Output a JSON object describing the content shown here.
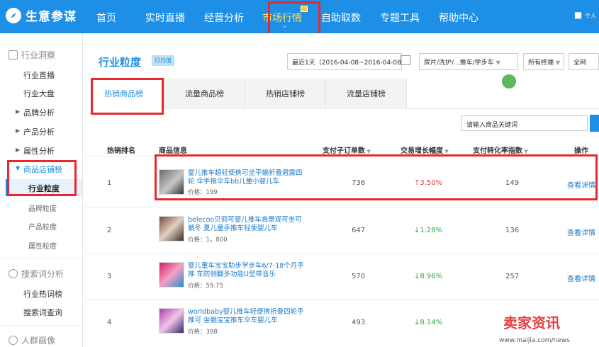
{
  "app": {
    "name": "生意参谋"
  },
  "nav": {
    "items": [
      "首页",
      "实时直播",
      "经营分析",
      "市场行情",
      "自助取数",
      "专题工具",
      "帮助中心"
    ],
    "user": "个人"
  },
  "sidebar": {
    "section1": "行业洞察",
    "items": [
      "行业直播",
      "行业大盘",
      "品牌分析",
      "产品分析",
      "属性分析",
      "商品店铺榜"
    ],
    "subitems": [
      "行业粒度",
      "品牌粒度",
      "产品粒度",
      "属性粒度"
    ],
    "section2": "搜索词分析",
    "items2": [
      "行业热词榜",
      "搜索词查询"
    ],
    "section3": "人群画像"
  },
  "main": {
    "title": "行业粒度",
    "tag": "日均值",
    "date_range": "最近1天（2016-04-08~2016-04-08）",
    "category": "尿片/洗护/...推车/学步车",
    "terminal": "所有终端",
    "scope": "全网",
    "tabs": [
      "热销商品榜",
      "流量商品榜",
      "热销店铺榜",
      "流量店铺榜"
    ],
    "search_placeholder": "请输入商品关键词"
  },
  "table": {
    "headers": [
      "热销排名",
      "商品信息",
      "支付子订单数",
      "交易增长幅度",
      "支付转化率指数",
      "操作"
    ],
    "rows": [
      {
        "rank": "1",
        "title": "婴儿推车超轻便携可坐平躺折叠避震四轮 伞手推伞车bb儿童小婴儿车",
        "price": "价格：199",
        "orders": "736",
        "growth": "3.50%",
        "growth_dir": "up",
        "conversion": "149",
        "action": "查看详情"
      },
      {
        "rank": "2",
        "title": "belecoo贝丽可婴儿推车高景观可坐可躺冬 夏儿童手推车轻便婴儿车",
        "price": "价格：1，800",
        "orders": "647",
        "growth": "1.28%",
        "growth_dir": "down",
        "conversion": "136",
        "action": "查看详情"
      },
      {
        "rank": "3",
        "title": "婴儿童车宝宝助步学步车6/7-18个月手推 车防侧翻多功能U型带音乐",
        "price": "价格：59.75",
        "orders": "570",
        "growth": "8.96%",
        "growth_dir": "down",
        "conversion": "257",
        "action": "查看详情"
      },
      {
        "rank": "4",
        "title": "worldbaby婴儿推车轻便携折叠四轮手推可 坐躺宝宝推车伞车婴儿车",
        "price": "价格：398",
        "orders": "493",
        "growth": "8.14%",
        "growth_dir": "down",
        "conversion": "",
        "action": ""
      }
    ]
  },
  "watermark": {
    "main": "卖家资讯",
    "url": "www.maijia.com/news"
  }
}
